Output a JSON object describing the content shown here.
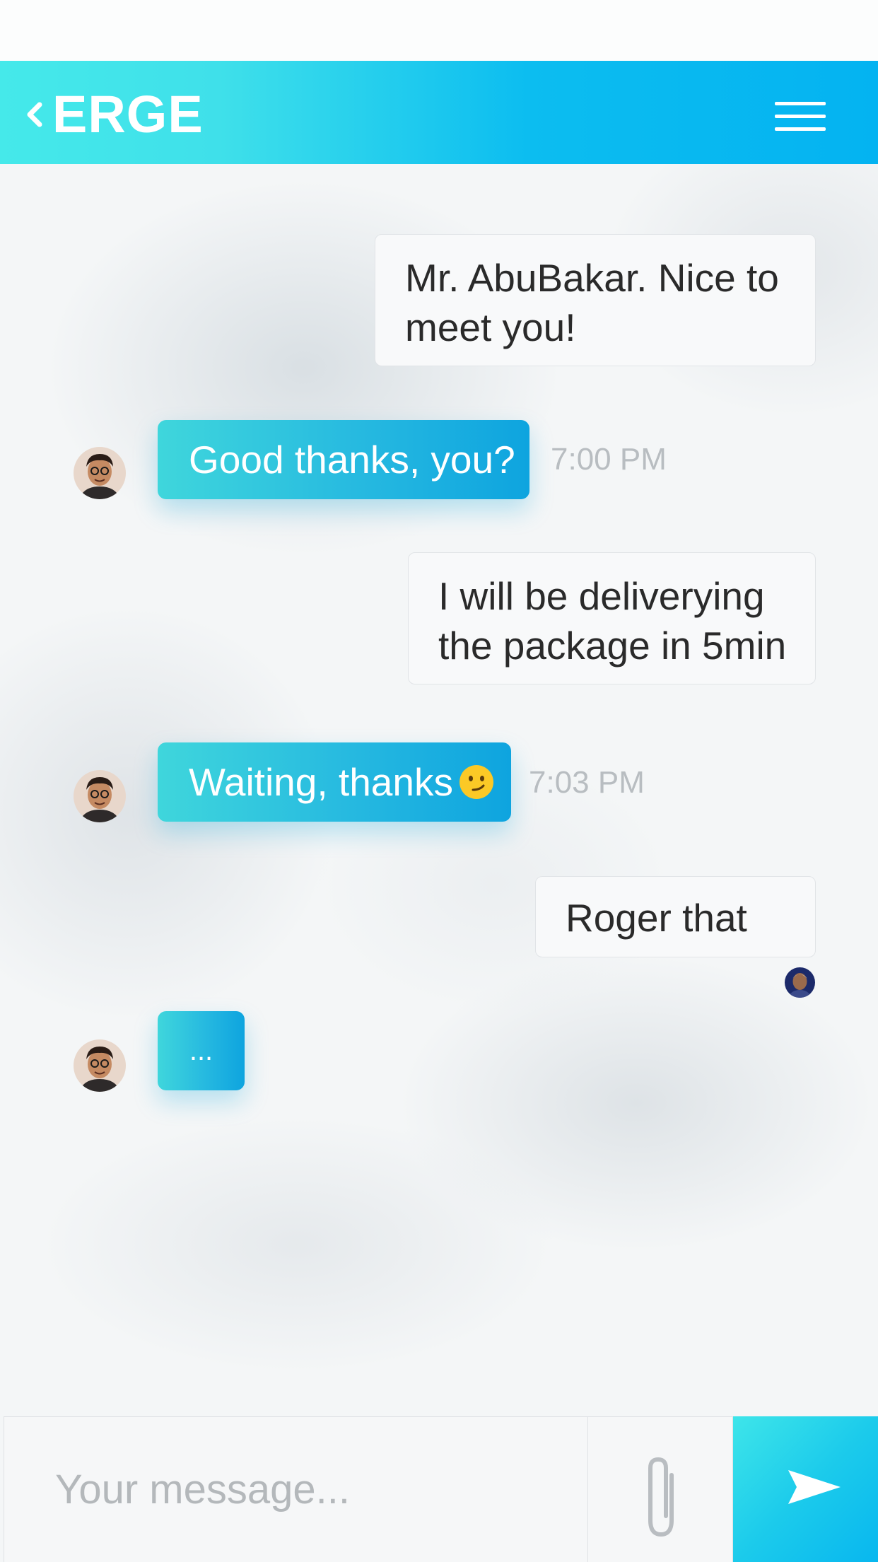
{
  "header": {
    "brand": "ERGE",
    "back_icon": "chevron-left-icon",
    "menu_icon": "hamburger-menu-icon"
  },
  "messages": [
    {
      "type": "outgoing",
      "lines": [
        "Mr. AbuBakar. Nice to",
        "meet you!"
      ]
    },
    {
      "type": "incoming",
      "text": "Good thanks, you?",
      "time": "7:00 PM",
      "avatar": "male-glasses-avatar"
    },
    {
      "type": "outgoing",
      "lines": [
        "I will be deliverying",
        "the package in 5min"
      ]
    },
    {
      "type": "incoming",
      "text": "Waiting, thanks",
      "emoji": "smirk-emoji-icon",
      "time": "7:03 PM",
      "avatar": "male-glasses-avatar"
    },
    {
      "type": "outgoing",
      "text": "Roger that",
      "read_avatar": "read-receipt-avatar"
    },
    {
      "type": "incoming",
      "text": "...",
      "typing": true,
      "avatar": "male-glasses-avatar"
    }
  ],
  "composer": {
    "placeholder": "Your message...",
    "attach_icon": "paperclip-icon",
    "send_icon": "send-arrow-icon"
  },
  "colors": {
    "header_gradient_start": "#45e9ea",
    "header_gradient_end": "#04b3f1",
    "incoming_bubble_start": "#3fd6dc",
    "incoming_bubble_end": "#0ea4df",
    "outgoing_bubble": "#f8f9fa",
    "timestamp": "#b8bdc1"
  }
}
